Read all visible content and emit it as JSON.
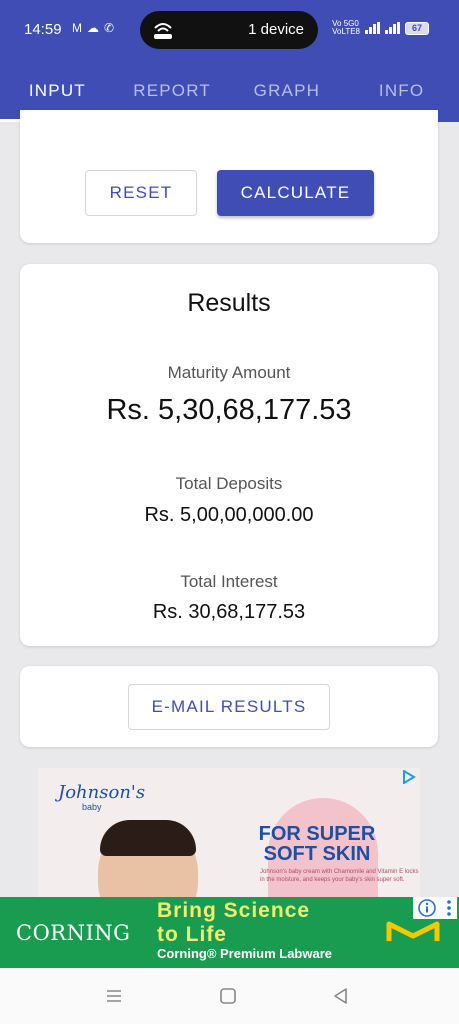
{
  "status_bar": {
    "time": "14:59",
    "pill_text": "1 device",
    "net_label": "Vo 5G0\nVoLTE8",
    "battery": "67"
  },
  "tabs": [
    {
      "label": "INPUT",
      "active": true
    },
    {
      "label": "REPORT",
      "active": false
    },
    {
      "label": "GRAPH",
      "active": false
    },
    {
      "label": "INFO",
      "active": false
    }
  ],
  "actions": {
    "reset_label": "RESET",
    "calculate_label": "CALCULATE"
  },
  "results": {
    "title": "Results",
    "maturity_label": "Maturity Amount",
    "maturity_value": "Rs. 5,30,68,177.53",
    "deposits_label": "Total Deposits",
    "deposits_value": "Rs. 5,00,00,000.00",
    "interest_label": "Total Interest",
    "interest_value": "Rs. 30,68,177.53"
  },
  "email": {
    "button_label": "E-MAIL RESULTS"
  },
  "ad": {
    "logo": "Johnson's",
    "logo_sub": "baby",
    "headline": "FOR SUPER SOFT SKIN",
    "fine_print": "Johnson's baby cream with Chamomile and Vitamin E locks in the moisture, and keeps your baby's skin super soft."
  },
  "banner": {
    "brand": "CORNING",
    "line1": "Bring Science",
    "line2": "to Life",
    "sub": "Corning® Premium Labware"
  },
  "colors": {
    "primary": "#3f4db5",
    "banner_green": "#199c4f"
  }
}
